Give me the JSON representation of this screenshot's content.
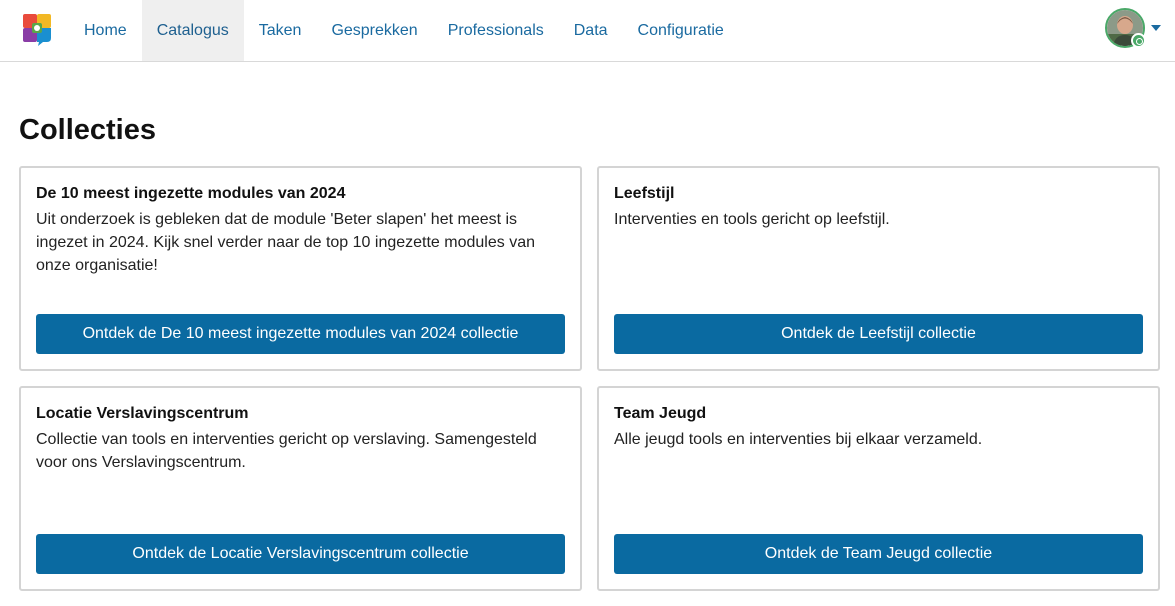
{
  "nav": {
    "items": [
      {
        "label": "Home",
        "active": false
      },
      {
        "label": "Catalogus",
        "active": true
      },
      {
        "label": "Taken",
        "active": false
      },
      {
        "label": "Gesprekken",
        "active": false
      },
      {
        "label": "Professionals",
        "active": false
      },
      {
        "label": "Data",
        "active": false
      },
      {
        "label": "Configuratie",
        "active": false
      }
    ],
    "logo_icon": "app-logo-icon",
    "user_status_color": "#4aa868"
  },
  "page": {
    "title": "Collecties"
  },
  "colors": {
    "accent": "#0a6aa1",
    "nav_link": "#1a6aa0"
  },
  "collections": [
    {
      "title": "De 10 meest ingezette modules van 2024",
      "description": "Uit onderzoek is gebleken dat de module 'Beter slapen' het meest is ingezet in 2024. Kijk snel verder naar de top 10 ingezette modules van onze organisatie!",
      "button_label": "Ontdek de De 10 meest ingezette modules van 2024 collectie"
    },
    {
      "title": "Leefstijl",
      "description": "Interventies en tools gericht op leefstijl.",
      "button_label": "Ontdek de Leefstijl collectie"
    },
    {
      "title": "Locatie Verslavingscentrum",
      "description": "Collectie van tools en interventies gericht op verslaving. Samengesteld voor ons Verslavingscentrum.",
      "button_label": "Ontdek de Locatie Verslavingscentrum collectie"
    },
    {
      "title": "Team Jeugd",
      "description": "Alle jeugd tools en interventies bij elkaar verzameld.",
      "button_label": "Ontdek de Team Jeugd collectie"
    }
  ]
}
